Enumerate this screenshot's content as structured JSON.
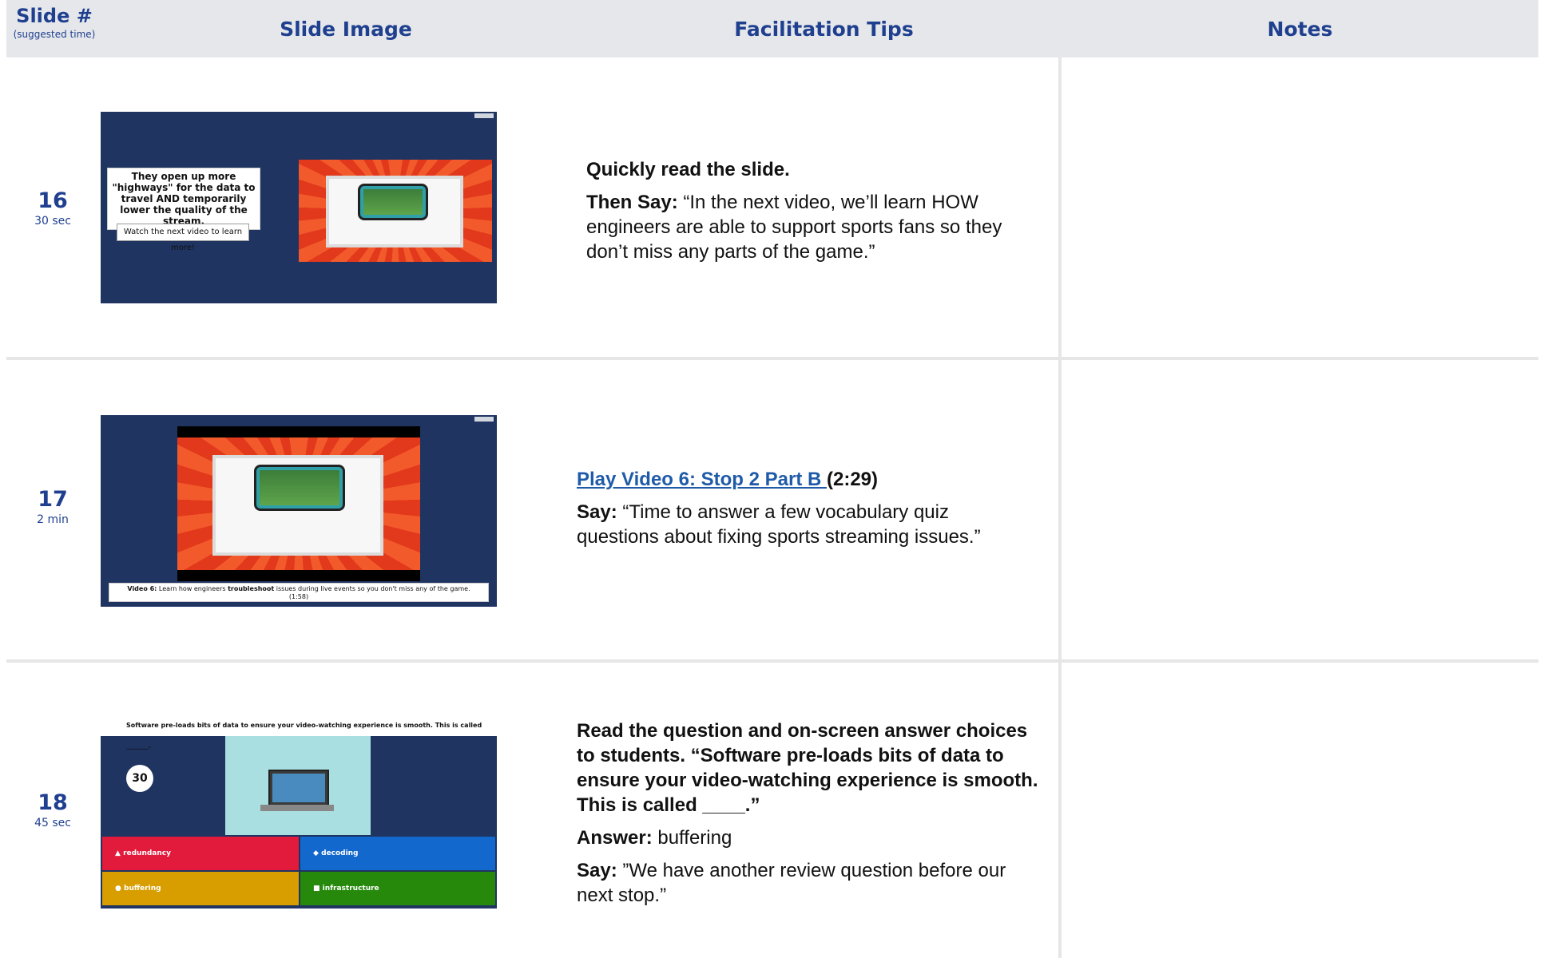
{
  "header": {
    "slide_col": "Slide #",
    "slide_col_sub": "(suggested time)",
    "image_col": "Slide Image",
    "tips_col": "Facilitation Tips",
    "notes_col": "Notes"
  },
  "rows": [
    {
      "number": "16",
      "time": "30 sec",
      "thumb": {
        "text": "They open up more \"highways\" for the data to travel AND temporarily lower the quality of the stream.",
        "button": "Watch the next video to learn more!"
      },
      "tips": {
        "lead": "Quickly read the slide.",
        "say_label": "Then Say:",
        "say_text": " “In the next video, we’ll learn HOW engineers are able to support sports fans so they don’t miss any parts of the game.”"
      }
    },
    {
      "number": "17",
      "time": "2 min",
      "thumb": {
        "caption_bold": "Video 6:",
        "caption_a": " Learn how engineers ",
        "caption_b": "troubleshoot",
        "caption_c": " issues during live events so you don't miss any of the game.",
        "duration": "(1:58)"
      },
      "tips": {
        "link": "Play Video 6: Stop 2 Part B ",
        "link_suffix": "(2:29)",
        "say_label": "Say:",
        "say_text": " “Time to answer a few vocabulary quiz questions about fixing sports streaming issues.”"
      }
    },
    {
      "number": "18",
      "time": "45 sec",
      "thumb": {
        "question": "Software pre-loads bits of data to ensure your video-watching experience is smooth. This is called _______.",
        "timer": "30",
        "answers": [
          "redundancy",
          "decoding",
          "buffering",
          "infrastructure"
        ]
      },
      "tips": {
        "lead": "Read the question and on-screen answer choices to students. “Software pre-loads bits of data to ensure your video-watching experience is smooth. This is called ____.”",
        "answer_label": "Answer:",
        "answer_text": " buffering",
        "say_label": "Say:",
        "say_text": " ”We have another review question before our next stop.”"
      }
    }
  ],
  "colors": {
    "header_bg": "#e5e7ea",
    "header_text": "#1f3f8f",
    "link": "#1f5ba8",
    "thumb_bg": "#1f3461",
    "answer_red": "#e21b3c",
    "answer_blue": "#1368ce",
    "answer_yellow": "#d89e00",
    "answer_green": "#26890c"
  }
}
